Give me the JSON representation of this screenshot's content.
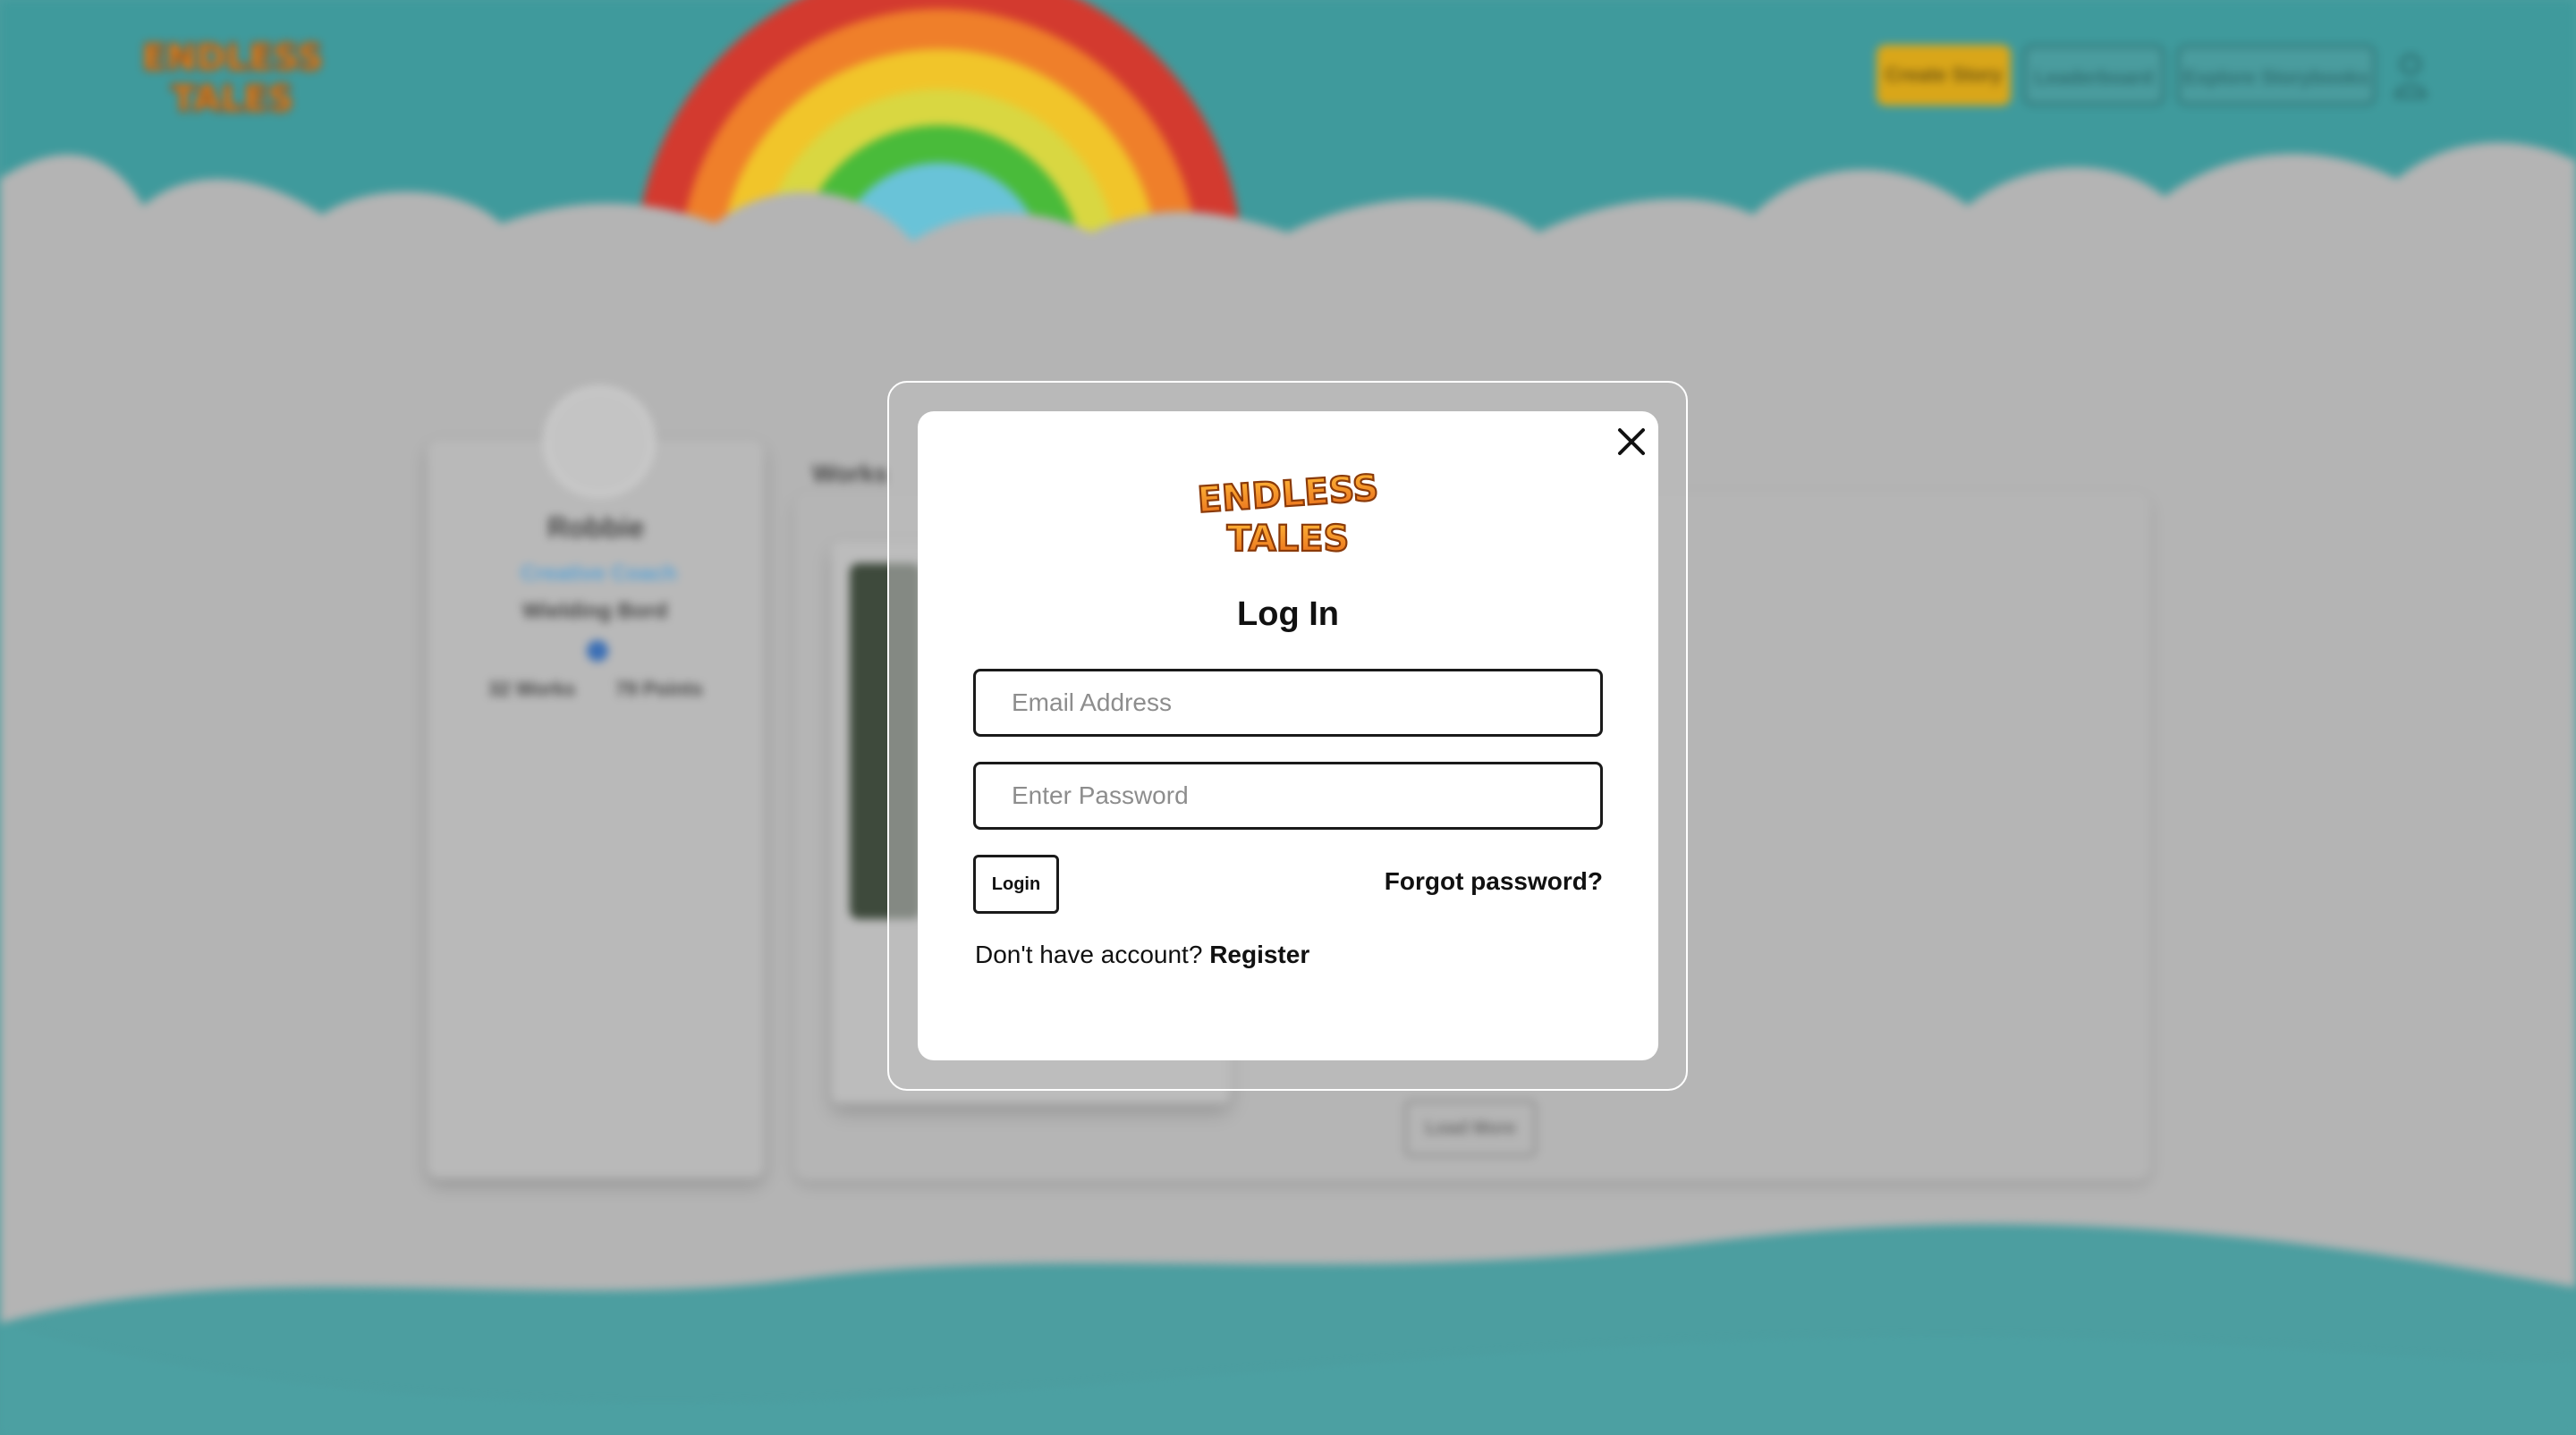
{
  "brand": {
    "logo_line1": "ENDLESS",
    "logo_line2": "TALES"
  },
  "background_page": {
    "nav": {
      "primary_label": "Create Story",
      "item2_label": "Leaderboard",
      "item3_label": "Explore Storybooks"
    },
    "profile": {
      "name": "Robbie",
      "subtitle": "Creative Coach",
      "tagline": "Wielding Bord",
      "works_count": "32 Works",
      "points_count": "79 Points"
    },
    "works_section_title": "Works",
    "load_more_label": "Load More"
  },
  "login_modal": {
    "title": "Log In",
    "email_placeholder": "Email Address",
    "password_placeholder": "Enter Password",
    "login_button": "Login",
    "forgot_password": "Forgot password?",
    "no_account_text": "Don't have account?",
    "register_link": "Register"
  },
  "colors": {
    "sky": "#3f9a9c",
    "modal_bg": "#ffffff",
    "logo_orange": "#f08a1c",
    "primary_button": "#d9a619"
  }
}
